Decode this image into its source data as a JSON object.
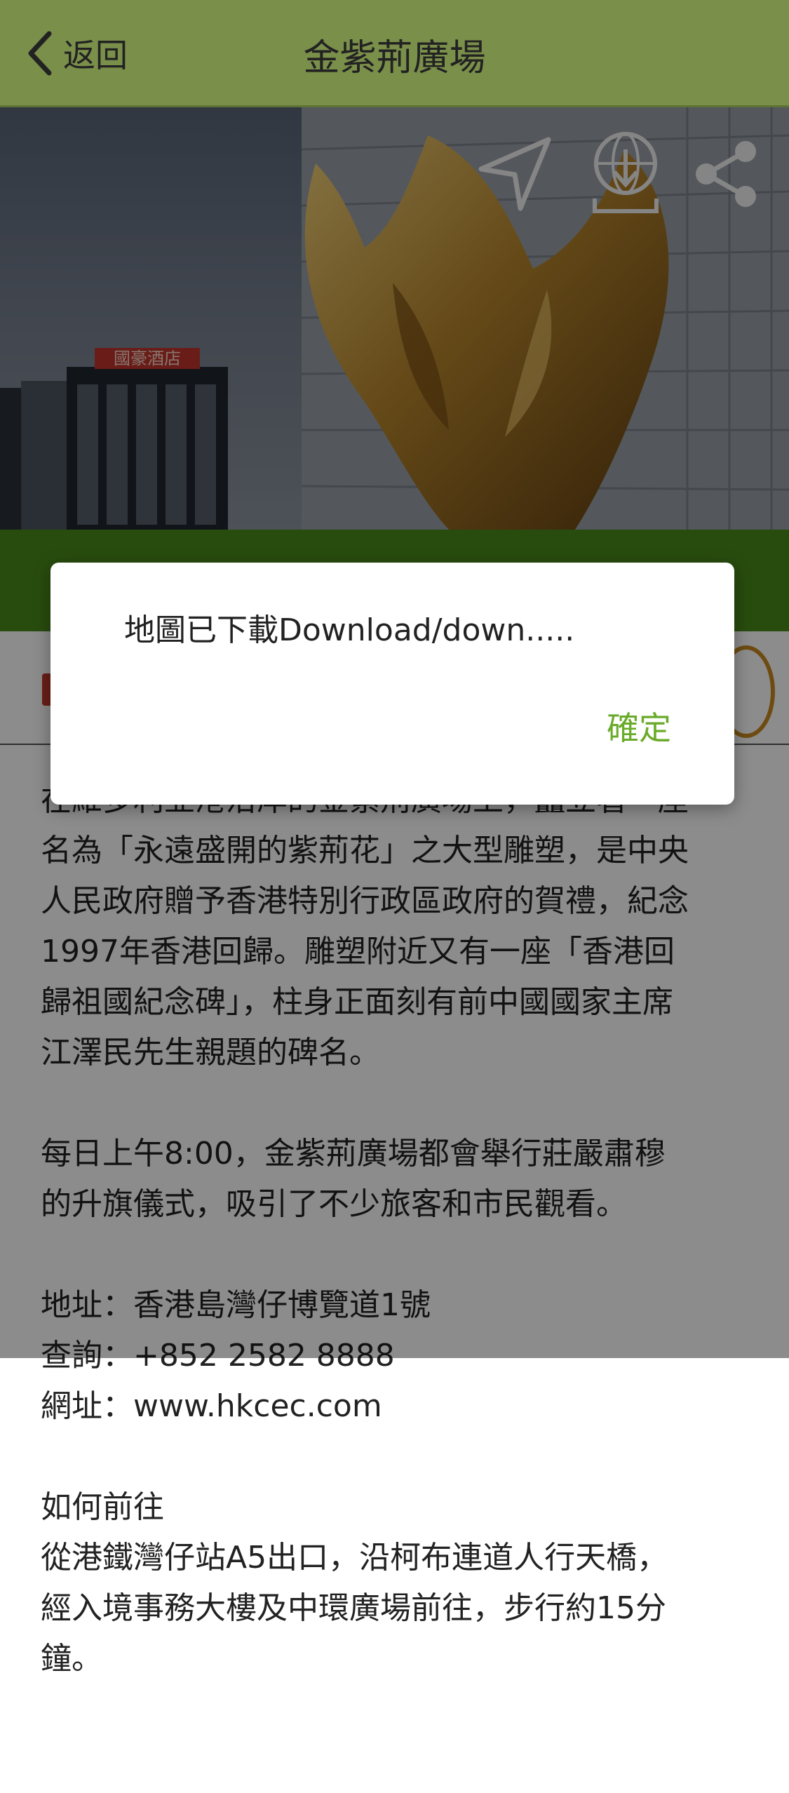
{
  "header": {
    "back_label": "返回",
    "title": "金紫荊廣場"
  },
  "hero": {
    "sign_text": "國豪酒店",
    "icons": [
      "navigate-icon",
      "download-map-icon",
      "share-icon"
    ]
  },
  "content": {
    "intro_partial_line": "在維多利亞港沿岸的金紫荊廣場上，矗立著一座",
    "intro_lines": [
      "名為「永遠盛開的紫荊花」之大型雕塑，是中央",
      "人民政府贈予香港特別行政區政府的賀禮，紀念",
      "1997年香港回歸。雕塑附近又有一座「香港回",
      "歸祖國紀念碑」，柱身正面刻有前中國國家主席",
      "江澤民先生親題的碑名。"
    ],
    "ceremony_lines": [
      "每日上午8:00，金紫荊廣場都會舉行莊嚴肅穆",
      "的升旗儀式，吸引了不少旅客和市民觀看。"
    ],
    "address": "地址：香港島灣仔博覽道1號",
    "enquiry": "查詢：+852 2582 8888",
    "website": "網址：www.hkcec.com",
    "howto_title": "如何前往",
    "howto_lines": [
      "從港鐵灣仔站A5出口，沿柯布連道人行天橋，",
      "經入境事務大樓及中環廣場前往，步行約15分",
      "鐘。"
    ]
  },
  "dialog": {
    "message": "地圖已下載Download/down.....",
    "ok_label": "確定"
  },
  "colors": {
    "header_bg": "#7a8f4a",
    "green_band": "#4a8b1a",
    "ok_text": "#6aab2a"
  }
}
